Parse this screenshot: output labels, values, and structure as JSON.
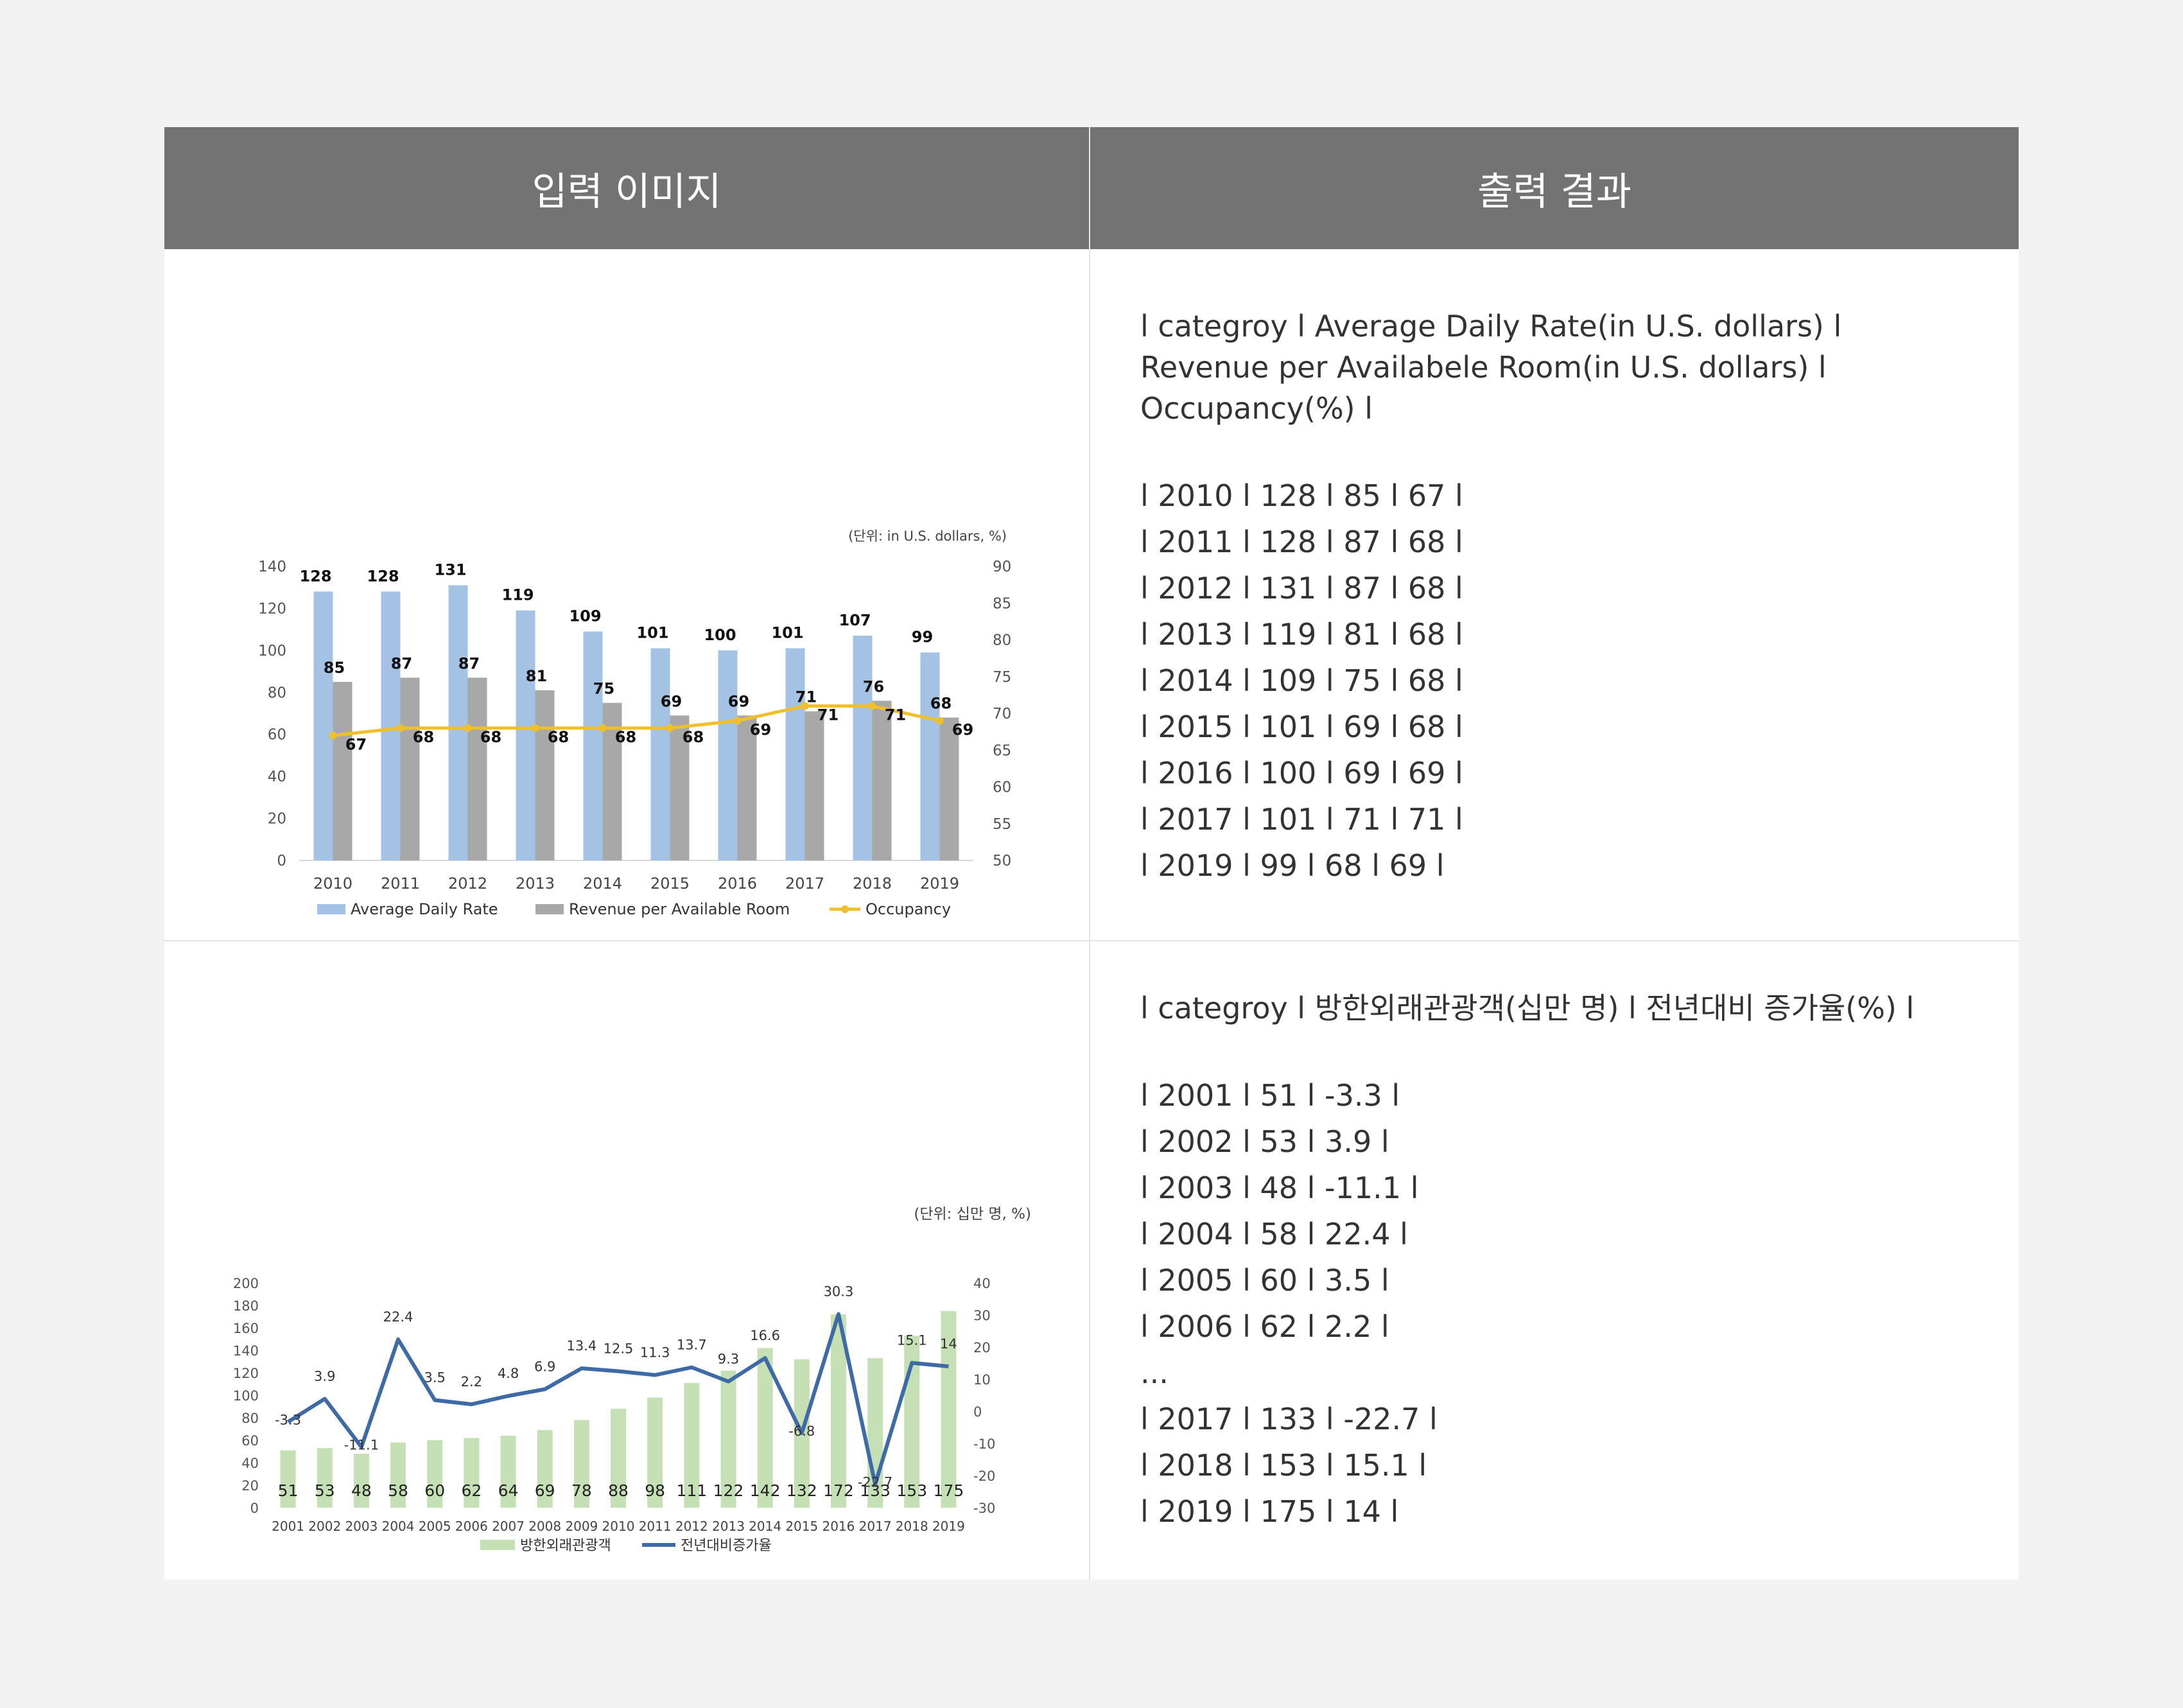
{
  "headers": {
    "left": "입력 이미지",
    "right": "출력 결과"
  },
  "chart_data": [
    {
      "type": "bar",
      "unit_note": "(단위: in U.S. dollars, %)",
      "categories": [
        "2010",
        "2011",
        "2012",
        "2013",
        "2014",
        "2015",
        "2016",
        "2017",
        "2018",
        "2019"
      ],
      "series": [
        {
          "name": "Average Daily Rate",
          "type": "bar",
          "axis": "left",
          "values": [
            128,
            128,
            131,
            119,
            109,
            101,
            100,
            101,
            107,
            99
          ]
        },
        {
          "name": "Revenue per Available Room",
          "type": "bar",
          "axis": "left",
          "values": [
            85,
            87,
            87,
            81,
            75,
            69,
            69,
            71,
            76,
            68
          ]
        },
        {
          "name": "Occupancy",
          "type": "line",
          "axis": "right",
          "values": [
            67,
            68,
            68,
            68,
            68,
            68,
            69,
            71,
            71,
            69
          ]
        }
      ],
      "ylim_left": [
        0,
        140
      ],
      "yticks_left": [
        0,
        20,
        40,
        60,
        80,
        100,
        120,
        140
      ],
      "ylim_right": [
        50,
        90
      ],
      "yticks_right": [
        50,
        55,
        60,
        65,
        70,
        75,
        80,
        85,
        90
      ],
      "legend": "bottom",
      "colors": {
        "bar1": "#a4c2e4",
        "bar2": "#a8a8a8",
        "line": "#f0c02c"
      }
    },
    {
      "type": "bar",
      "unit_note": "(단위: 십만 명, %)",
      "categories": [
        "2001",
        "2002",
        "2003",
        "2004",
        "2005",
        "2006",
        "2007",
        "2008",
        "2009",
        "2010",
        "2011",
        "2012",
        "2013",
        "2014",
        "2015",
        "2016",
        "2017",
        "2018",
        "2019"
      ],
      "series": [
        {
          "name": "방한외래관광객",
          "type": "bar",
          "axis": "left",
          "values": [
            51,
            53,
            48,
            58,
            60,
            62,
            64,
            69,
            78,
            88,
            98,
            111,
            122,
            142,
            132,
            172,
            133,
            153,
            175
          ]
        },
        {
          "name": "전년대비증가율",
          "type": "line",
          "axis": "right",
          "values": [
            -3.3,
            3.9,
            -11.1,
            22.4,
            3.5,
            2.2,
            4.8,
            6.9,
            13.4,
            12.5,
            11.3,
            13.7,
            9.3,
            16.6,
            -6.8,
            30.3,
            -22.7,
            15.1,
            14
          ]
        }
      ],
      "ylim_left": [
        0,
        200
      ],
      "yticks_left": [
        0,
        20,
        40,
        60,
        80,
        100,
        120,
        140,
        160,
        180,
        200
      ],
      "ylim_right": [
        -30,
        40
      ],
      "yticks_right": [
        -30,
        -20,
        -10,
        0,
        10,
        20,
        30,
        40
      ],
      "legend": "bottom",
      "colors": {
        "bar": "#c5e0b4",
        "line": "#3e6aa6"
      }
    }
  ],
  "output1": {
    "header_lines": [
      "l categroy l Average Daily Rate(in U.S. dollars) l",
      "Revenue per Availabele Room(in U.S. dollars) l",
      "Occupancy(%) l"
    ],
    "rows": [
      "l 2010 l 128 l 85 l 67 l",
      "l 2011 l 128 l 87 l 68 l",
      "l 2012 l 131 l 87 l 68 l",
      "l 2013 l 119 l 81 l 68 l",
      "l 2014 l 109 l 75 l 68 l",
      "l 2015 l 101 l 69 l 68 l",
      "l 2016 l 100 l 69 l 69 l",
      "l 2017 l 101 l 71 l 71 l",
      "l 2019 l 99 l 68 l 69 l"
    ]
  },
  "output2": {
    "header_lines": [
      "l categroy l 방한외래관광객(십만 명) l 전년대비 증가율(%) l"
    ],
    "rows": [
      "l 2001 l 51 l -3.3 l",
      "l 2002 l 53 l 3.9 l",
      "l 2003 l 48 l -11.1 l",
      "l 2004 l 58 l 22.4 l",
      "l 2005 l 60 l 3.5 l",
      "l 2006 l 62 l 2.2 l",
      "...",
      "l 2017 l 133 l -22.7 l",
      "l 2018 l 153 l 15.1 l",
      "l 2019 l 175 l 14 l"
    ]
  }
}
